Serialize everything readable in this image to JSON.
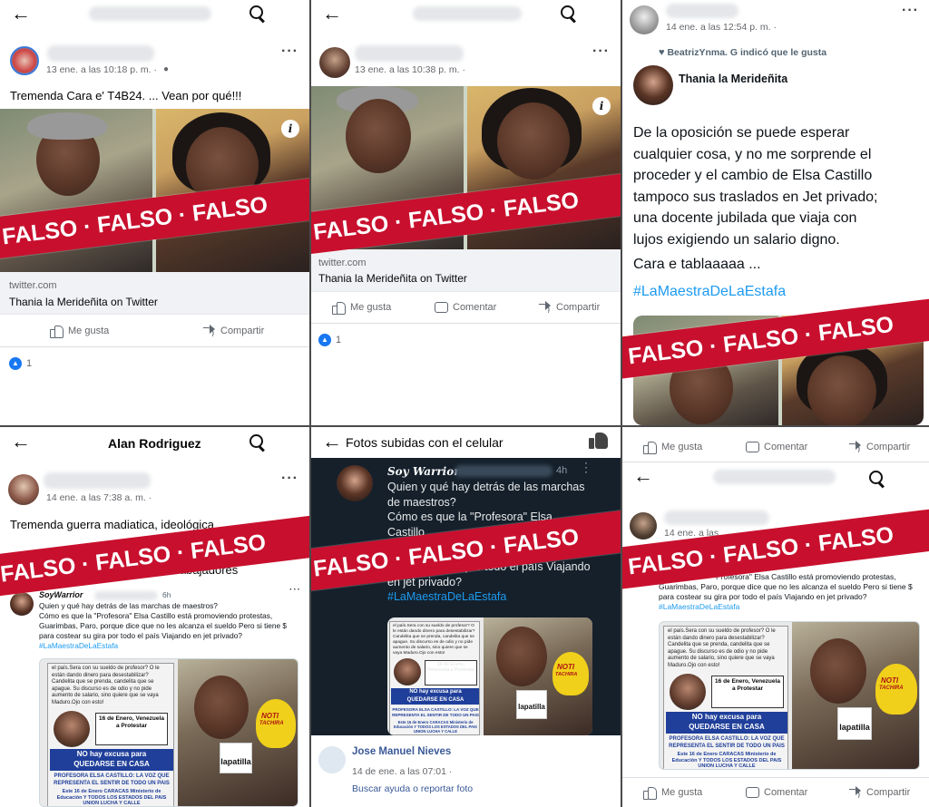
{
  "labels": {
    "falso": "FALSO",
    "bullet": "·"
  },
  "panel1": {
    "timestamp": "13 ene. a las 10:18 p. m. ·",
    "post_text": "Tremenda Cara e' T4B24. ... Vean por qué!!!",
    "link_domain": "twitter.com",
    "link_title": "Thania la Merideñita on Twitter",
    "like_label": "Me gusta",
    "share_label": "Compartir",
    "reactions_count": "1"
  },
  "panel2": {
    "timestamp": "13 ene. a las 10:38 p. m. ·",
    "link_domain": "twitter.com",
    "link_title": "Thania la Merideñita on Twitter",
    "like_label": "Me gusta",
    "comment_label": "Comentar",
    "share_label": "Compartir",
    "reactions_count": "1"
  },
  "panel3": {
    "timestamp": "14 ene. a las 12:54 p. m. ·",
    "liked_by": "BeatrizYnma. G indicó que le gusta",
    "author": "Thania la Merideñita",
    "tweet_lines": [
      "De la oposición se puede esperar",
      "cualquier cosa, y no me sorprende el",
      "proceder y el cambio de Elsa Castillo",
      "tampoco sus traslados en Jet privado;",
      "una docente jubilada que viaja con",
      "lujos exigiendo un salario digno.",
      "Cara e tablaaaaa ..."
    ],
    "hashtag": "#LaMaestraDeLaEstafa"
  },
  "panel4": {
    "header": "Alan Rodriguez",
    "timestamp": "14 ene. a las 7:38 a. m. ·",
    "post_line1": "Tremenda guerra madiatica, ideológica",
    "post_line2": "trabajadores",
    "tweet_author": "SoyWarrior",
    "tweet_time": "6h",
    "tweet_lines": [
      "Quien y qué hay detrás de las marchas de maestros?",
      "Cómo es que la \"Profesora\" Elsa Castillo está promoviendo protestas,",
      "Guarimbas, Paro, porque dice que no les alcanza el sueldo Pero si tiene $",
      "para costear su gira por todo el país Viajando en jet privado?"
    ],
    "hashtag": "#LaMaestraDeLaEstafa"
  },
  "panel5": {
    "header": "Fotos subidas con el celular",
    "tweet_author": "Soy Warrior",
    "tweet_time": "4h",
    "tweet_lines": [
      "Quien y qué hay detrás de las marchas",
      "de maestros?",
      "Cómo es que la \"Profesora\" Elsa",
      "Castillo",
      "costear su gira por todo el país Viajando",
      "en jet privado?"
    ],
    "hashtag": "#LaMaestraDeLaEstafa",
    "commenter": "Jose Manuel Nieves",
    "comment_time": "14 de ene. a las 07:01 ·",
    "help_link": "Buscar ayuda o reportar foto"
  },
  "panel6": {
    "like_label": "Me gusta",
    "comment_label": "Comentar",
    "share_label": "Compartir",
    "timestamp": "14 ene. a las",
    "tweet_lines": [
      "Elsa Castillo está promoviendo protestas,",
      "Guarimbas, Paro, porque dice que no les alcanza el sueldo Pero si tiene $",
      "para costear su gira por todo el país Viajando en jet privado?"
    ],
    "tweet_prefix": "\"Profesora\"",
    "hashtag": "#LaMaestraDeLaEstafa"
  },
  "flyer": {
    "date": "16 de Enero, Venezuela a Protestar",
    "headline1": "NO hay excusa para",
    "headline2": "QUEDARSE EN CASA",
    "sub": "PROFESORA ELSA CASTILLO: LA VOZ QUE REPRESENTA EL SENTIR DE TODO UN PAIS",
    "place": "Este 16 de Enero CARACAS Ministerio de Educación Y TODOS LOS ESTADOS DEL PAIS UNION LUCHA Y CALLE",
    "caption": "el país.Sera con su sueldo de profesor? O le están dando dinero para desestabilizar? Candelita que se prenda, candelita que se apague. Su discurso es de odio y no pide aumento de salario, sino quiere que se vaya Maduro.Ojo con esto!"
  },
  "mic": {
    "brand1": "NOTI",
    "brand2": "TACHIRA",
    "station": "lapatilla"
  },
  "colors": {
    "falso_red": "#c8102e",
    "facebook_blue": "#1877f2",
    "twitter_blue": "#1d9bf0",
    "dark_bg": "#15202b"
  }
}
